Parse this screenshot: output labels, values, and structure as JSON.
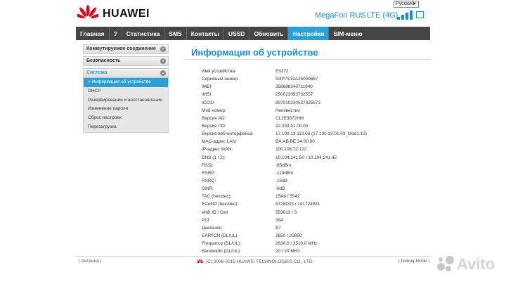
{
  "header": {
    "brand": "HUAWEI",
    "language": "Русский",
    "operator": "MegaFon RUS",
    "network_type": "LTE (4G)"
  },
  "nav": [
    {
      "label": "Главная",
      "active": false
    },
    {
      "label": "?",
      "active": false
    },
    {
      "label": "Статистика",
      "active": false
    },
    {
      "label": "SMS",
      "active": false
    },
    {
      "label": "Контакты",
      "active": false
    },
    {
      "label": "USSD",
      "active": false
    },
    {
      "label": "Обновить",
      "active": false
    },
    {
      "label": "Настройки",
      "active": true
    },
    {
      "label": "SIM-меню",
      "active": false
    }
  ],
  "sidebar": {
    "groups": [
      {
        "label": "Коммутируемое соединение",
        "ctrl": "›"
      },
      {
        "label": "Безопасность",
        "ctrl": "›"
      },
      {
        "label": "Система",
        "ctrl": "⌄"
      }
    ],
    "items": [
      {
        "label": "> Информация об устройстве",
        "active": true
      },
      {
        "label": "DHCP",
        "active": false
      },
      {
        "label": "Резервирование и восстановление",
        "active": false
      },
      {
        "label": "Изменение пароля",
        "active": false
      },
      {
        "label": "Сброс настроек",
        "active": false
      },
      {
        "label": "Перезагрузка",
        "active": false
      }
    ]
  },
  "main": {
    "title": "Информация об устройстве",
    "rows": [
      {
        "k": "Имя устройства:",
        "v": "E3372"
      },
      {
        "k": "Серийный номер:",
        "v": "G4P7S19A25000687"
      },
      {
        "k": "IMEI:",
        "v": "358688240711940"
      },
      {
        "k": "IMSI:",
        "v": "250023053732557"
      },
      {
        "k": "ICCID:",
        "v": "897010230537325573"
      },
      {
        "k": "Мой номер:",
        "v": "Неизвестно"
      },
      {
        "k": "Версия АО:",
        "v": "CL2E3372HM"
      },
      {
        "k": "Версия ПО:",
        "v": "22.333.01.00.00"
      },
      {
        "k": "Версия веб-интерфейса:",
        "v": "17.100.13.113.03 (17.100.13.01.03_Mod1.13)"
      },
      {
        "k": "MAC-адрес LAN:",
        "v": "BA:AB:BE:34:00:00"
      },
      {
        "k": "IP-адрес WAN:",
        "v": "100.106.72.122"
      },
      {
        "k": "DNS (1 / 2):",
        "v": "10.104.241.50 / 10.104.241.42"
      },
      {
        "k": "RSSI:",
        "v": "-65dBm"
      },
      {
        "k": "RSRP:",
        "v": "-119dBm"
      },
      {
        "k": "RSRQ:",
        "v": "-15dB"
      },
      {
        "k": "SINR:",
        "v": "-8dB"
      },
      {
        "k": "TAC (hex/dec):",
        "v": "15A6 / 5542"
      },
      {
        "k": "ECellID (hex/dec):",
        "v": "8728D03 / 141724931"
      },
      {
        "k": "eNB ID / Cell:",
        "v": "553613 / 3"
      },
      {
        "k": "PCI:",
        "v": "364"
      },
      {
        "k": "Диапазон:",
        "v": "B7"
      },
      {
        "k": "EARFCN (DL/UL):",
        "v": "2850 / 20850"
      },
      {
        "k": "Frequency (DL/UL):",
        "v": "2630.0 / 2510.0 MHz"
      },
      {
        "k": "Bandwidth (DL/UL):",
        "v": "20 / 20 MHz"
      }
    ]
  },
  "footer": {
    "left": "Антенна",
    "copyright": "(C) 2006-2015 HUAWEI TECHNOLOGIES CO., LTD.",
    "right": "Debug Mode"
  },
  "watermark": {
    "text": "Avito"
  },
  "colors": {
    "accent": "#2b9fd6",
    "nav_bg": "#454545",
    "brand_red": "#e1001a"
  }
}
